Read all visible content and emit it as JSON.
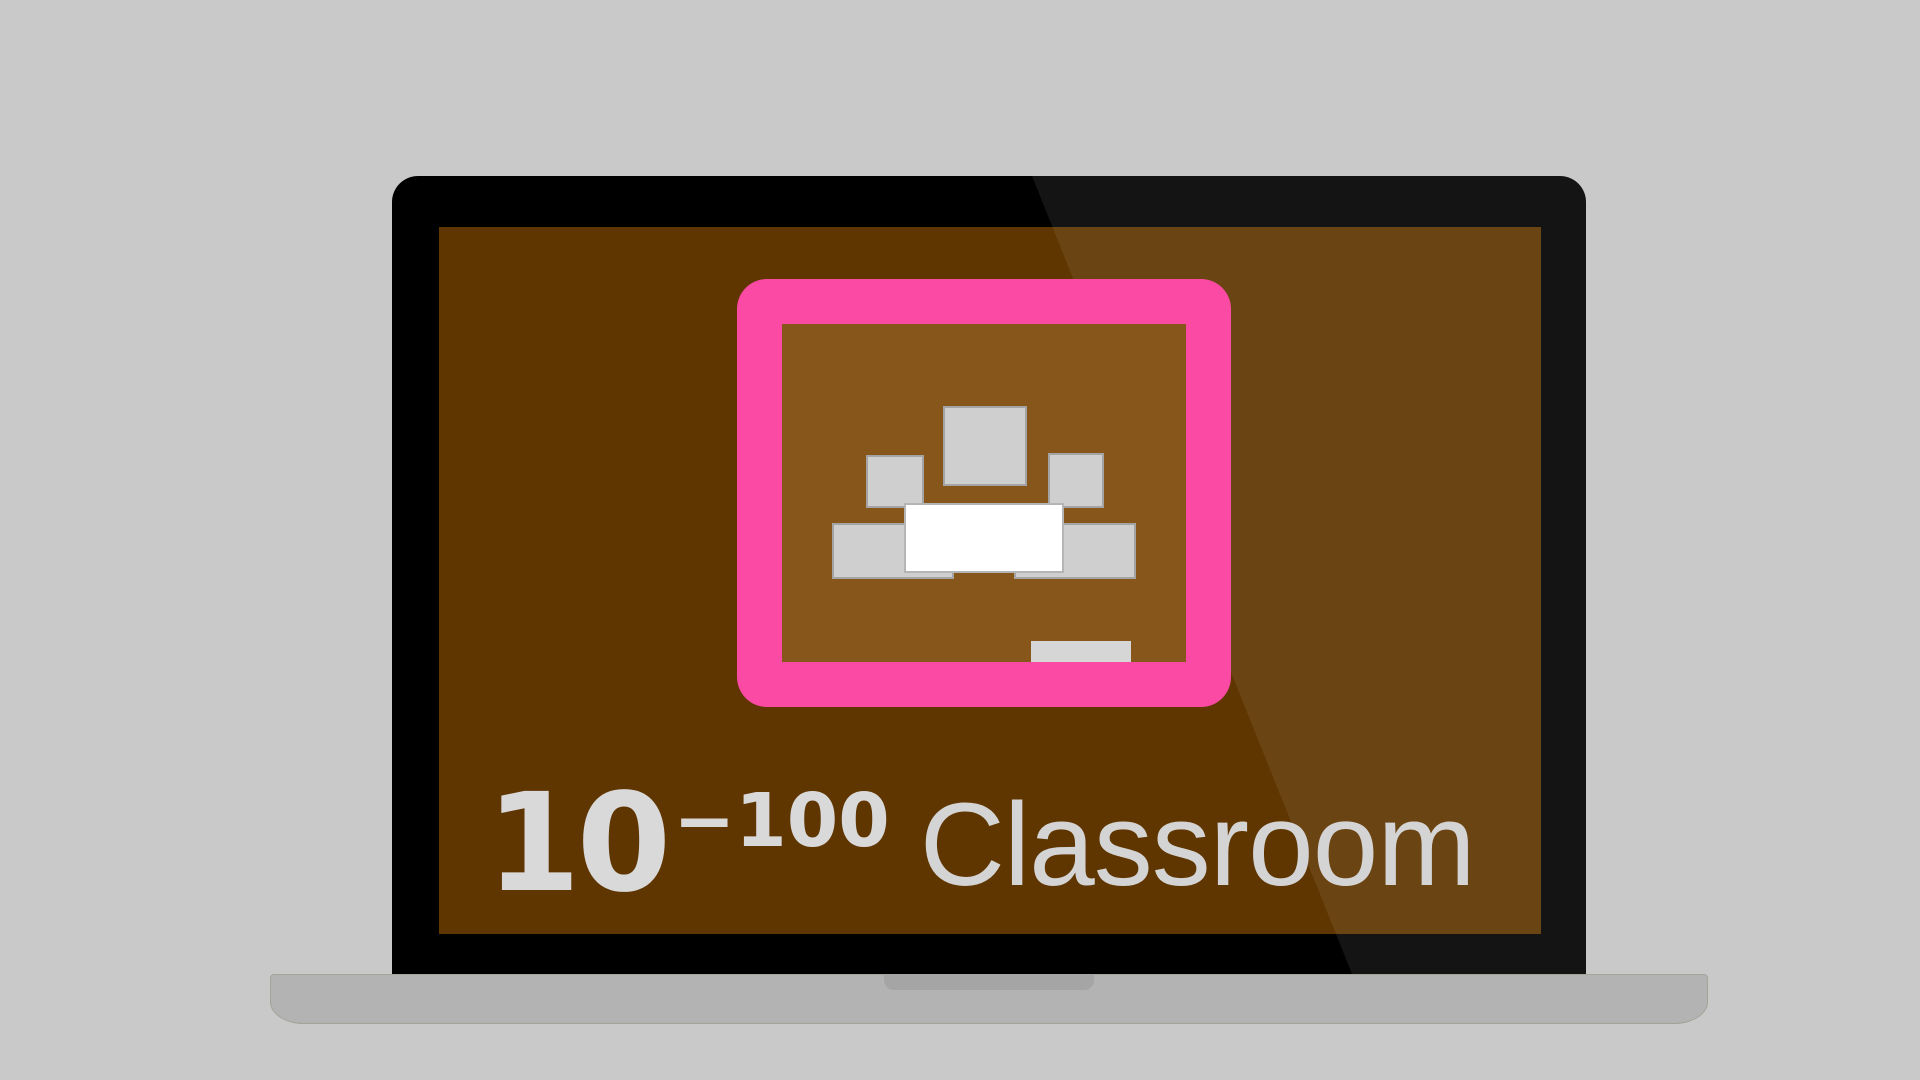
{
  "caption": {
    "base": "10",
    "exponent": "−100",
    "word": "Classroom"
  },
  "logo": {
    "icon": "google-classroom-board-icon"
  },
  "colors": {
    "background": "#c9c9c9",
    "bezel": "#000000",
    "screen": "#5f3500",
    "board_frame": "#fa4aa3",
    "board_surface": "#87561a",
    "text": "#d9d9d9",
    "laptop_base": "#b3b3b3"
  }
}
